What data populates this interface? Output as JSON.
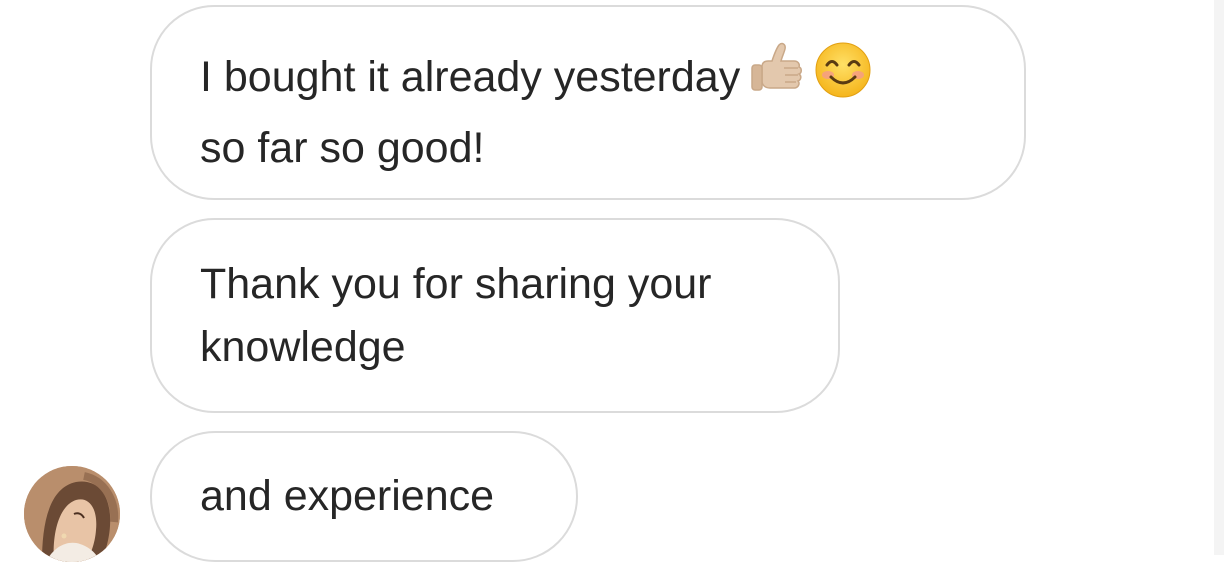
{
  "messages": [
    {
      "lines": [
        "I bought it already yesterday",
        "so far so good!"
      ],
      "emojis": [
        "thumbs-up-icon",
        "smiling-face-icon"
      ]
    },
    {
      "lines": [
        "Thank you for sharing your",
        "knowledge"
      ]
    },
    {
      "lines": [
        "and experience"
      ]
    }
  ],
  "colors": {
    "bubble_border": "#dbdbdb",
    "text": "#262626",
    "background": "#ffffff"
  }
}
